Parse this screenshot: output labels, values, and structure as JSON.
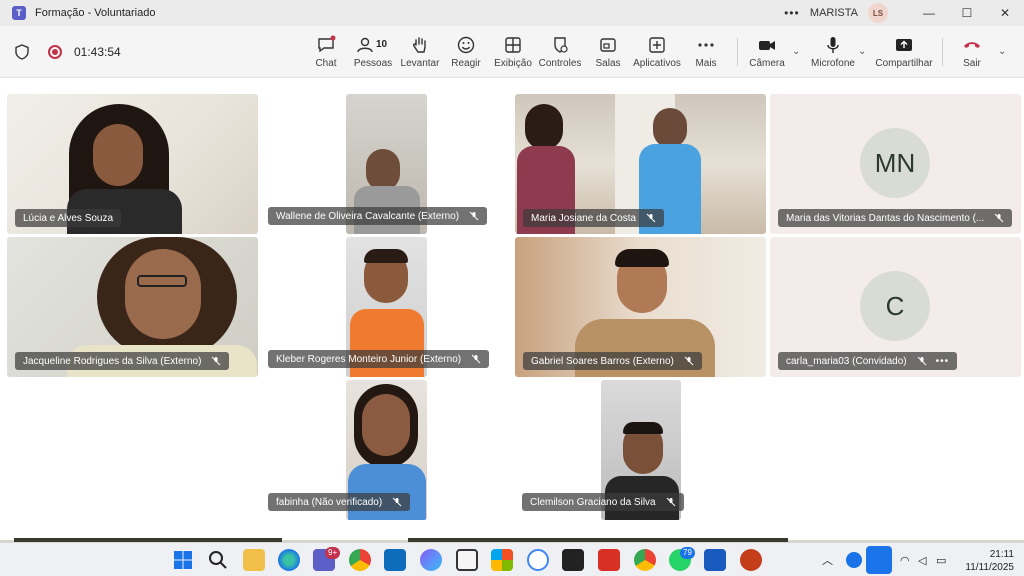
{
  "window": {
    "title": "Formação - Voluntariado",
    "org": "MARISTA",
    "user_initials": "LS",
    "app_letter": "T"
  },
  "meeting": {
    "timer": "01:43:54",
    "people_count": "10"
  },
  "toolbar": {
    "chat": "Chat",
    "people": "Pessoas",
    "raise": "Levantar",
    "react": "Reagir",
    "view": "Exibição",
    "controls": "Controles",
    "rooms": "Salas",
    "apps": "Aplicativos",
    "more": "Mais",
    "camera": "Câmera",
    "mic": "Microfone",
    "share": "Compartilhar",
    "leave": "Sair"
  },
  "participants": [
    {
      "name": "Lúcia e Alves Souza"
    },
    {
      "name": "Wallene de Oliveira Cavalcante (Externo)"
    },
    {
      "name": "Maria Josiane da Costa"
    },
    {
      "name": "Maria das Vitorias Dantas do Nascimento (...",
      "initials": "MN"
    },
    {
      "name": "Jacqueline Rodrigues da Silva (Externo)"
    },
    {
      "name": "Kleber Rogeres Monteiro Junior (Externo)"
    },
    {
      "name": "Gabriel Soares Barros (Externo)"
    },
    {
      "name": "carla_maria03 (Convidado)",
      "initials": "C"
    },
    {
      "name": "fabinha (Não verificado)"
    },
    {
      "name": "Clemilson Graciano da Silva"
    }
  ],
  "taskbar": {
    "teams_badge": "9+",
    "whatsapp_badge": "79",
    "time": "21:11",
    "date": "11/11/2025"
  },
  "colors": {
    "accent": "#5b5fc7",
    "leave": "#c4314b",
    "recording": "#c4314b"
  }
}
